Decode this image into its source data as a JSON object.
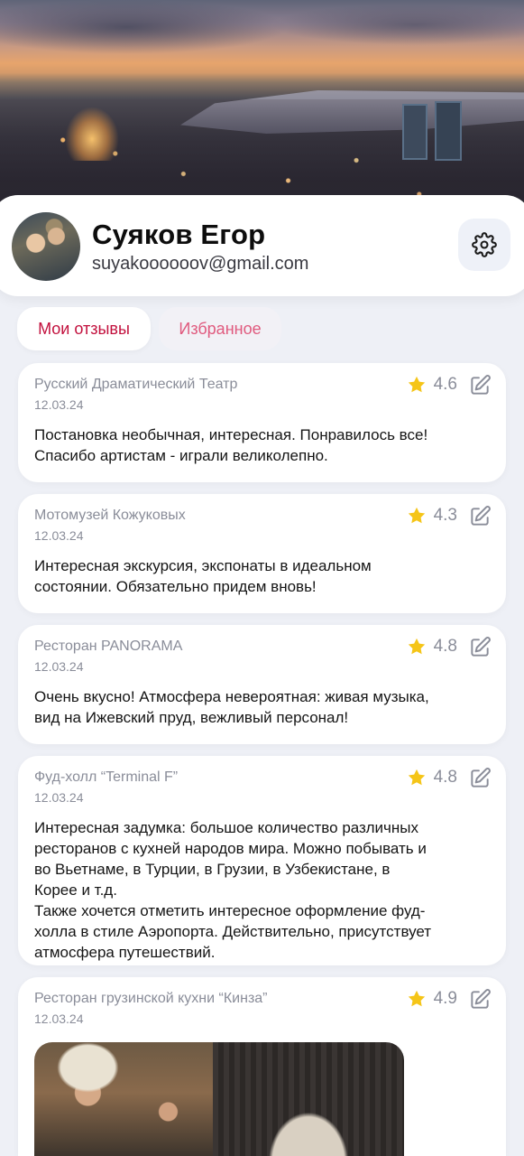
{
  "profile": {
    "name": "Суяков Егор",
    "email": "suyakoooooov@gmail.com"
  },
  "tabs": {
    "reviews": "Мои отзывы",
    "favorites": "Избранное",
    "active": "reviews"
  },
  "colors": {
    "accent": "#c2103d",
    "star": "#f5c518",
    "muted_text": "#8a8d99",
    "background": "#eef0f6"
  },
  "icons": {
    "settings": "gear-icon",
    "rating": "star-icon",
    "edit": "edit-icon"
  },
  "reviews": [
    {
      "place": "Русский Драматический Театр",
      "date": "12.03.24",
      "rating": "4.6",
      "text": "Постановка необычная, интересная. Понравилось все!\nСпасибо артистам - играли великолепно."
    },
    {
      "place": "Мотомузей Кожуковых",
      "date": "12.03.24",
      "rating": "4.3",
      "text": "Интересная экскурсия, экспонаты в идеальном\nсостоянии. Обязательно придем вновь!"
    },
    {
      "place": "Ресторан PANORAMA",
      "date": "12.03.24",
      "rating": "4.8",
      "text": "Очень вкусно! Атмосфера невероятная: живая музыка,\nвид на Ижевский пруд, вежливый персонал!"
    },
    {
      "place": "Фуд-холл “Terminal F”",
      "date": "12.03.24",
      "rating": "4.8",
      "text": "Интересная задумка: большое количество различных\nресторанов с кухней народов мира. Можно побывать и\nво Вьетнаме, в Турции, в Грузии, в Узбекистане, в\nКорее и т.д.\nТакже хочется отметить интересное оформление фуд-\nхолла в стиле Аэропорта. Действительно, присутствует\nатмосфера путешествий."
    },
    {
      "place": "Ресторан грузинской кухни “Кинза”",
      "date": "12.03.24",
      "rating": "4.9",
      "text": ""
    }
  ]
}
